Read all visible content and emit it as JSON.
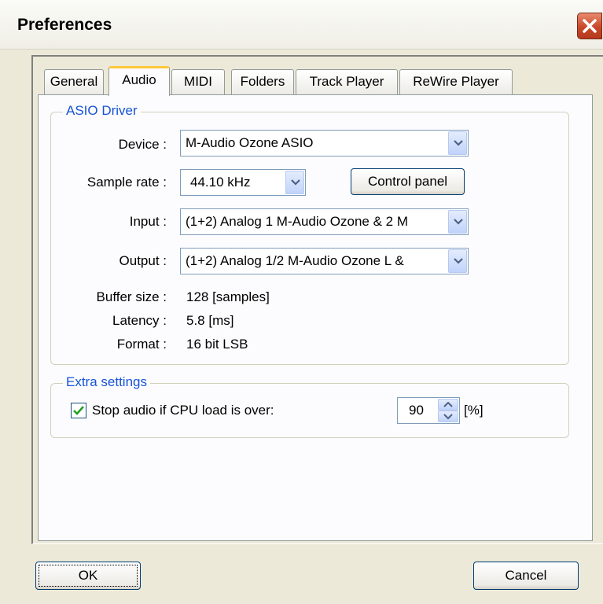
{
  "window": {
    "title": "Preferences",
    "close_icon": "close-icon"
  },
  "tabs": [
    {
      "label": "General",
      "active": false
    },
    {
      "label": "Audio",
      "active": true
    },
    {
      "label": "MIDI",
      "active": false
    },
    {
      "label": "Folders",
      "active": false
    },
    {
      "label": "Track Player",
      "active": false
    },
    {
      "label": "ReWire Player",
      "active": false
    }
  ],
  "asio": {
    "legend": "ASIO Driver",
    "device_label": "Device :",
    "device_value": "M-Audio Ozone ASIO",
    "sample_rate_label": "Sample rate :",
    "sample_rate_value": "44.10 kHz",
    "control_panel_label": "Control panel",
    "input_label": "Input :",
    "input_value": "(1+2) Analog 1 M-Audio Ozone & 2 M",
    "output_label": "Output :",
    "output_value": "(1+2) Analog 1/2 M-Audio Ozone L &",
    "buffer_label": "Buffer size :",
    "buffer_value": "128 [samples]",
    "latency_label": "Latency :",
    "latency_value": "5.8 [ms]",
    "format_label": "Format :",
    "format_value": "16 bit LSB"
  },
  "extra": {
    "legend": "Extra settings",
    "cpu_checkbox_checked": true,
    "cpu_label": "Stop audio if CPU load is over:",
    "cpu_value": "90",
    "cpu_unit": "[%]"
  },
  "buttons": {
    "ok": "OK",
    "cancel": "Cancel"
  },
  "colors": {
    "accent": "#1553d6",
    "active_tab": "#ffc83c",
    "close": "#c9472a"
  }
}
